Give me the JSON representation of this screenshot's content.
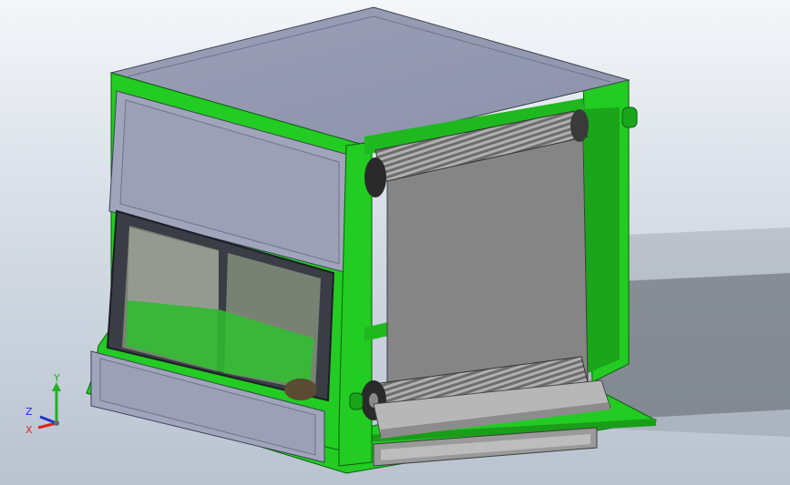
{
  "viewport": {
    "background_top": "#f4f6f9",
    "background_bottom": "#b9c3d0"
  },
  "model": {
    "frame_color": "#22cc22",
    "panel_color": "#9ea3b8",
    "roller_color": "#8d8d8d",
    "belt_color": "#858585"
  },
  "triad": {
    "y_label": "Y",
    "z_label": "Z",
    "x_label": "X",
    "y_color": "#23b223",
    "z_color": "#2233cc",
    "x_color": "#dd2222"
  }
}
